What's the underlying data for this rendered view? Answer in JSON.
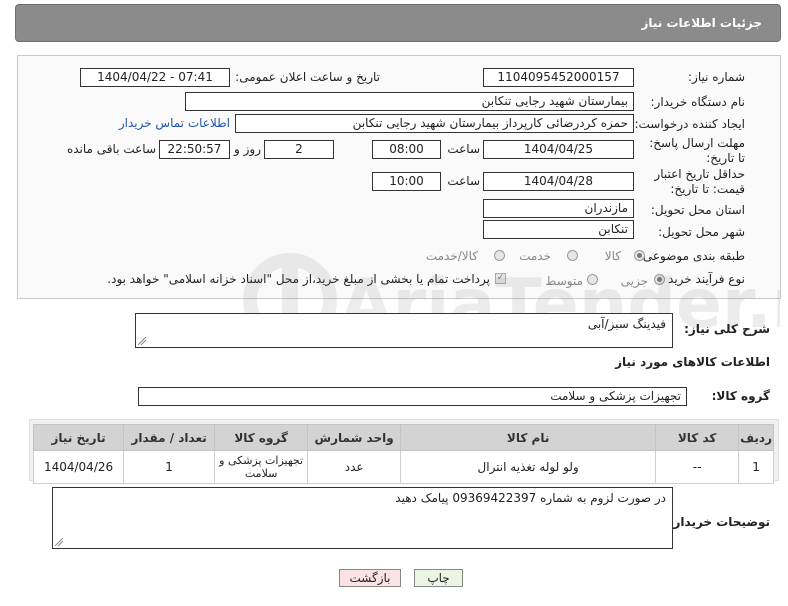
{
  "header": {
    "title": "جزئیات اطلاعات نیاز"
  },
  "form": {
    "need_number_label": "شماره نیاز:",
    "need_number": "1104095452000157",
    "announce_label": "تاریخ و ساعت اعلان عمومی:",
    "announce_value": "1404/04/22 - 07:41",
    "buyer_label": "نام دستگاه خریدار:",
    "buyer_value": "بیمارستان شهید رجایی تنکابن",
    "creator_label": "ایجاد کننده درخواست:",
    "creator_value": "حمزه کردرضائی کارپرداز بیمارستان شهید رجایی تنکابن",
    "contact_link": "اطلاعات تماس خریدار",
    "deadline_label": "مهلت ارسال پاسخ: تا تاریخ:",
    "deadline_date": "1404/04/25",
    "time_label": "ساعت",
    "deadline_time": "08:00",
    "days_value": "2",
    "days_label": "روز و",
    "remaining_time": "22:50:57",
    "remaining_label": "ساعت باقی مانده",
    "validity_label": "حداقل تاریخ اعتبار قیمت: تا تاریخ:",
    "validity_date": "1404/04/28",
    "validity_time_label": "ساعت",
    "validity_time": "10:00",
    "province_label": "استان محل تحویل:",
    "province_value": "مازندران",
    "city_label": "شهر محل تحویل:",
    "city_value": "تنکابن",
    "category_label": "طبقه بندی موضوعی:",
    "category_options": [
      "کالا",
      "خدمت",
      "کالا/خدمت"
    ],
    "process_label": "نوع فرآیند خرید :",
    "process_options": [
      "جزیی",
      "متوسط"
    ],
    "process_note": "پرداخت تمام یا بخشی از مبلغ خرید،از محل \"اسناد خزانه اسلامی\" خواهد بود."
  },
  "description": {
    "label": "شرح کلی نیاز:",
    "value": "فیدینگ سبز/آبی"
  },
  "goods": {
    "section_title": "اطلاعات کالاهای مورد نیاز",
    "group_label": "گروه کالا:",
    "group_value": "تجهیزات پزشکی و سلامت",
    "columns": [
      "ردیف",
      "کد کالا",
      "نام کالا",
      "واحد شمارش",
      "گروه کالا",
      "تعداد / مقدار",
      "تاریخ نیاز"
    ],
    "rows": [
      {
        "row": "1",
        "code": "--",
        "name": "ولو لوله تغذیه انترال",
        "unit": "عدد",
        "group": "تجهیزات پزشکی و سلامت",
        "qty": "1",
        "date": "1404/04/26"
      }
    ]
  },
  "buyer_notes": {
    "label": "توضیحات خریدار:",
    "value": "در صورت لزوم به شماره 09369422397 پیامک دهید"
  },
  "buttons": {
    "print": "چاپ",
    "back": "بازگشت"
  },
  "watermark_text": "AriaTender.neT"
}
